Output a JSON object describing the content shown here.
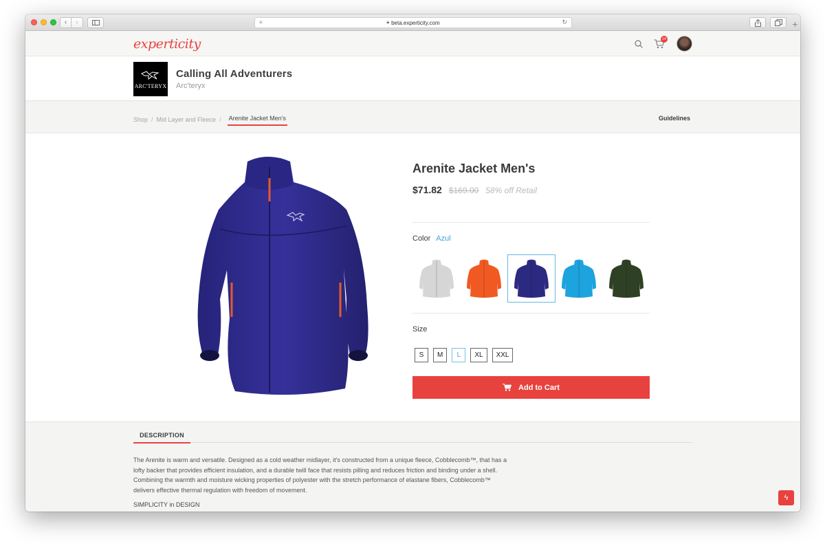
{
  "browser": {
    "url": "beta.experticity.com",
    "forward_glyph": "›",
    "back_glyph": "‹",
    "new_tab_glyph": "+"
  },
  "header": {
    "logo": "experticity",
    "cart_count": "14",
    "accent_color": "#e8423f"
  },
  "brand": {
    "logo_text": "ARC'TERYX",
    "title": "Calling All Adventurers",
    "name": "Arc'teryx"
  },
  "breadcrumb": {
    "items": [
      "Shop",
      "Mid Layer and Fleece",
      "Arenite Jacket Men's"
    ],
    "separator": "/",
    "guidelines": "Guidelines"
  },
  "product": {
    "title": "Arenite Jacket Men's",
    "price": "$71.82",
    "retail_price": "$169.00",
    "discount": "58% off Retail",
    "color_label": "Color",
    "color_value": "Azul",
    "colors": [
      {
        "name": "grey",
        "hex": "#d6d6d6"
      },
      {
        "name": "orange",
        "hex": "#f05a22"
      },
      {
        "name": "azul",
        "hex": "#2c2a80"
      },
      {
        "name": "blue",
        "hex": "#1da3dd"
      },
      {
        "name": "green",
        "hex": "#2f4124"
      }
    ],
    "selected_color_index": 2,
    "size_label": "Size",
    "sizes": [
      "S",
      "M",
      "L",
      "XL",
      "XXL"
    ],
    "selected_size": "L",
    "add_to_cart": "Add to Cart"
  },
  "description": {
    "tab": "DESCRIPTION",
    "text": "The Arenite is warm and versatile. Designed as a cold weather midlayer, it's constructed from a unique fleece, Cobblecomb™, that has a lofty backer that provides efficient insulation, and a durable twill face that resists pilling and reduces friction and binding under a shell. Combining the warmth and moisture wicking properties of polyester with the stretch performance of elastane fibers, Cobblecomb™ delivers effective thermal regulation with freedom of movement.",
    "subheading": "SIMPLICITY in DESIGN"
  }
}
